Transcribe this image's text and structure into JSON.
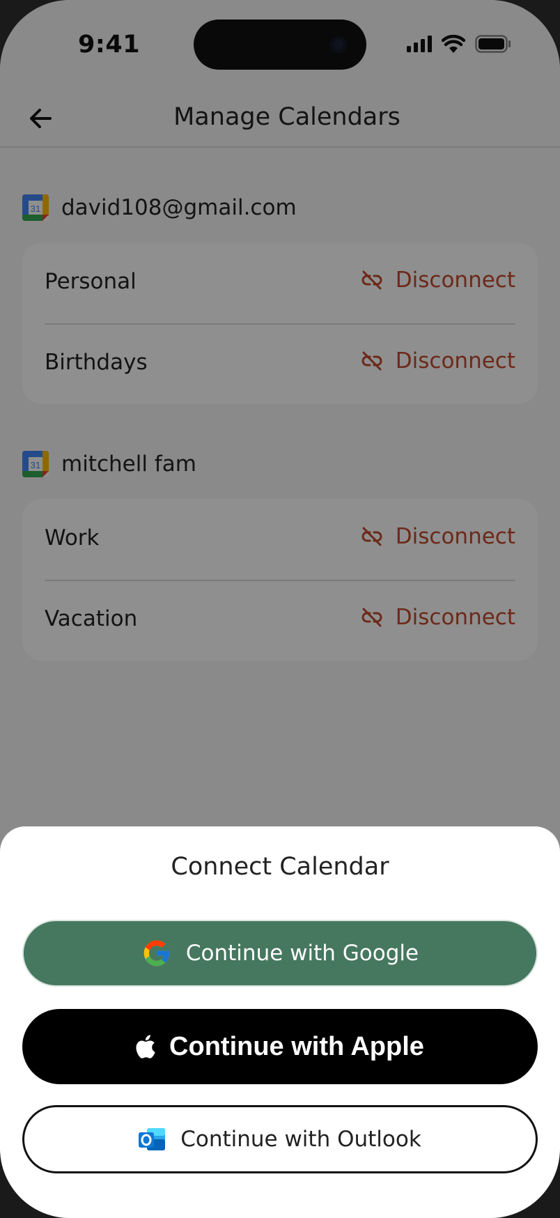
{
  "status_bar": {
    "time": "9:41"
  },
  "header": {
    "title": "Manage Calendars"
  },
  "accounts": [
    {
      "name": "david108@gmail.com",
      "icon_number": "31",
      "calendars": [
        {
          "label": "Personal",
          "action": "Disconnect"
        },
        {
          "label": "Birthdays",
          "action": "Disconnect"
        }
      ]
    },
    {
      "name": "mitchell fam",
      "icon_number": "31",
      "calendars": [
        {
          "label": "Work",
          "action": "Disconnect"
        },
        {
          "label": "Vacation",
          "action": "Disconnect"
        }
      ]
    }
  ],
  "sheet": {
    "title": "Connect Calendar",
    "google_label": "Continue with Google",
    "apple_label": "Continue with Apple",
    "outlook_label": "Continue with Outlook"
  },
  "colors": {
    "disconnect": "#c0492e",
    "google_button": "#46775f",
    "apple_button": "#000000"
  }
}
